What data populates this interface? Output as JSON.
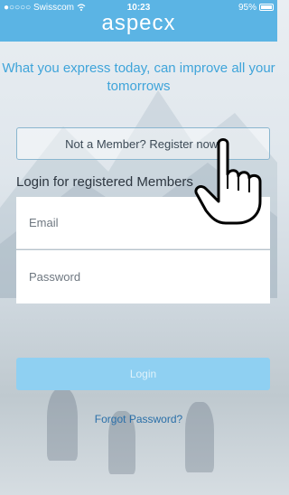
{
  "status_bar": {
    "carrier": "●○○○○ Swisscom",
    "time": "10:23",
    "battery": "95%"
  },
  "header": {
    "logo": "aspecx"
  },
  "tagline": "What you express today, can improve all your tomorrows",
  "register_button": "Not a Member?  Register now!",
  "login_title": "Login for registered Members",
  "form": {
    "email_placeholder": "Email",
    "password_placeholder": "Password",
    "login_button": "Login"
  },
  "forgot_password": "Forgot Password?",
  "colors": {
    "brand": "#5bb4e4",
    "button_disabled": "#8fd0f2",
    "link": "#2a6fa8"
  },
  "icons": [
    "wifi-icon",
    "battery-icon",
    "hand-pointer-icon"
  ]
}
